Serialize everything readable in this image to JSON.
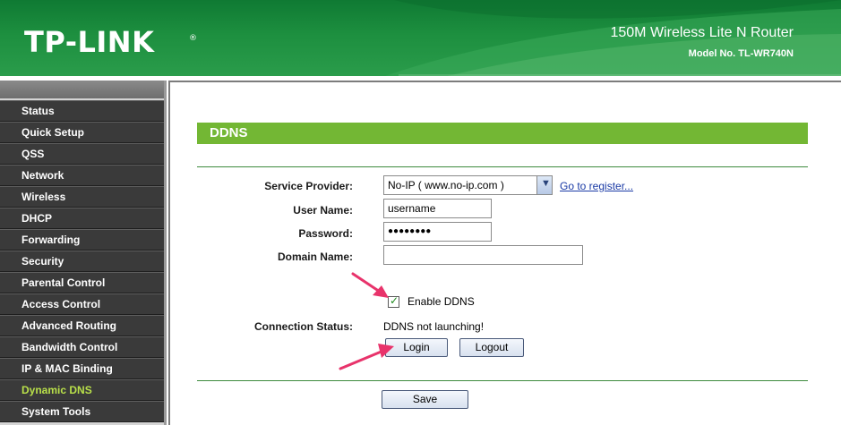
{
  "header": {
    "logo": "TP-LINK",
    "logo_mark": "®",
    "product_name": "150M Wireless Lite N Router",
    "model_no": "Model No. TL-WR740N"
  },
  "sidebar": {
    "items": [
      {
        "label": "Status"
      },
      {
        "label": "Quick Setup"
      },
      {
        "label": "QSS"
      },
      {
        "label": "Network"
      },
      {
        "label": "Wireless"
      },
      {
        "label": "DHCP"
      },
      {
        "label": "Forwarding"
      },
      {
        "label": "Security"
      },
      {
        "label": "Parental Control"
      },
      {
        "label": "Access Control"
      },
      {
        "label": "Advanced Routing"
      },
      {
        "label": "Bandwidth Control"
      },
      {
        "label": "IP & MAC Binding"
      },
      {
        "label": "Dynamic DNS"
      },
      {
        "label": "System Tools"
      }
    ],
    "active": "Dynamic DNS"
  },
  "main": {
    "title": "DDNS",
    "service_provider": {
      "label": "Service Provider:",
      "value": "No-IP ( www.no-ip.com )",
      "register_link": "Go to register..."
    },
    "user_name": {
      "label": "User Name:",
      "value": "username"
    },
    "password": {
      "label": "Password:",
      "masked_value": "●●●●●●●●"
    },
    "domain_name": {
      "label": "Domain Name:",
      "value": ""
    },
    "enable_ddns": {
      "label": "Enable DDNS",
      "checked": true
    },
    "connection_status": {
      "label": "Connection Status:",
      "value": "DDNS not launching!"
    },
    "login_button": "Login",
    "logout_button": "Logout",
    "save_button": "Save"
  },
  "colors": {
    "header_green": "#1d8f3f",
    "title_bar_green": "#73b734",
    "sidebar_dark": "#3a3a3a",
    "active_menu": "#b9e04a",
    "annotation_arrow": "#e8336b"
  }
}
